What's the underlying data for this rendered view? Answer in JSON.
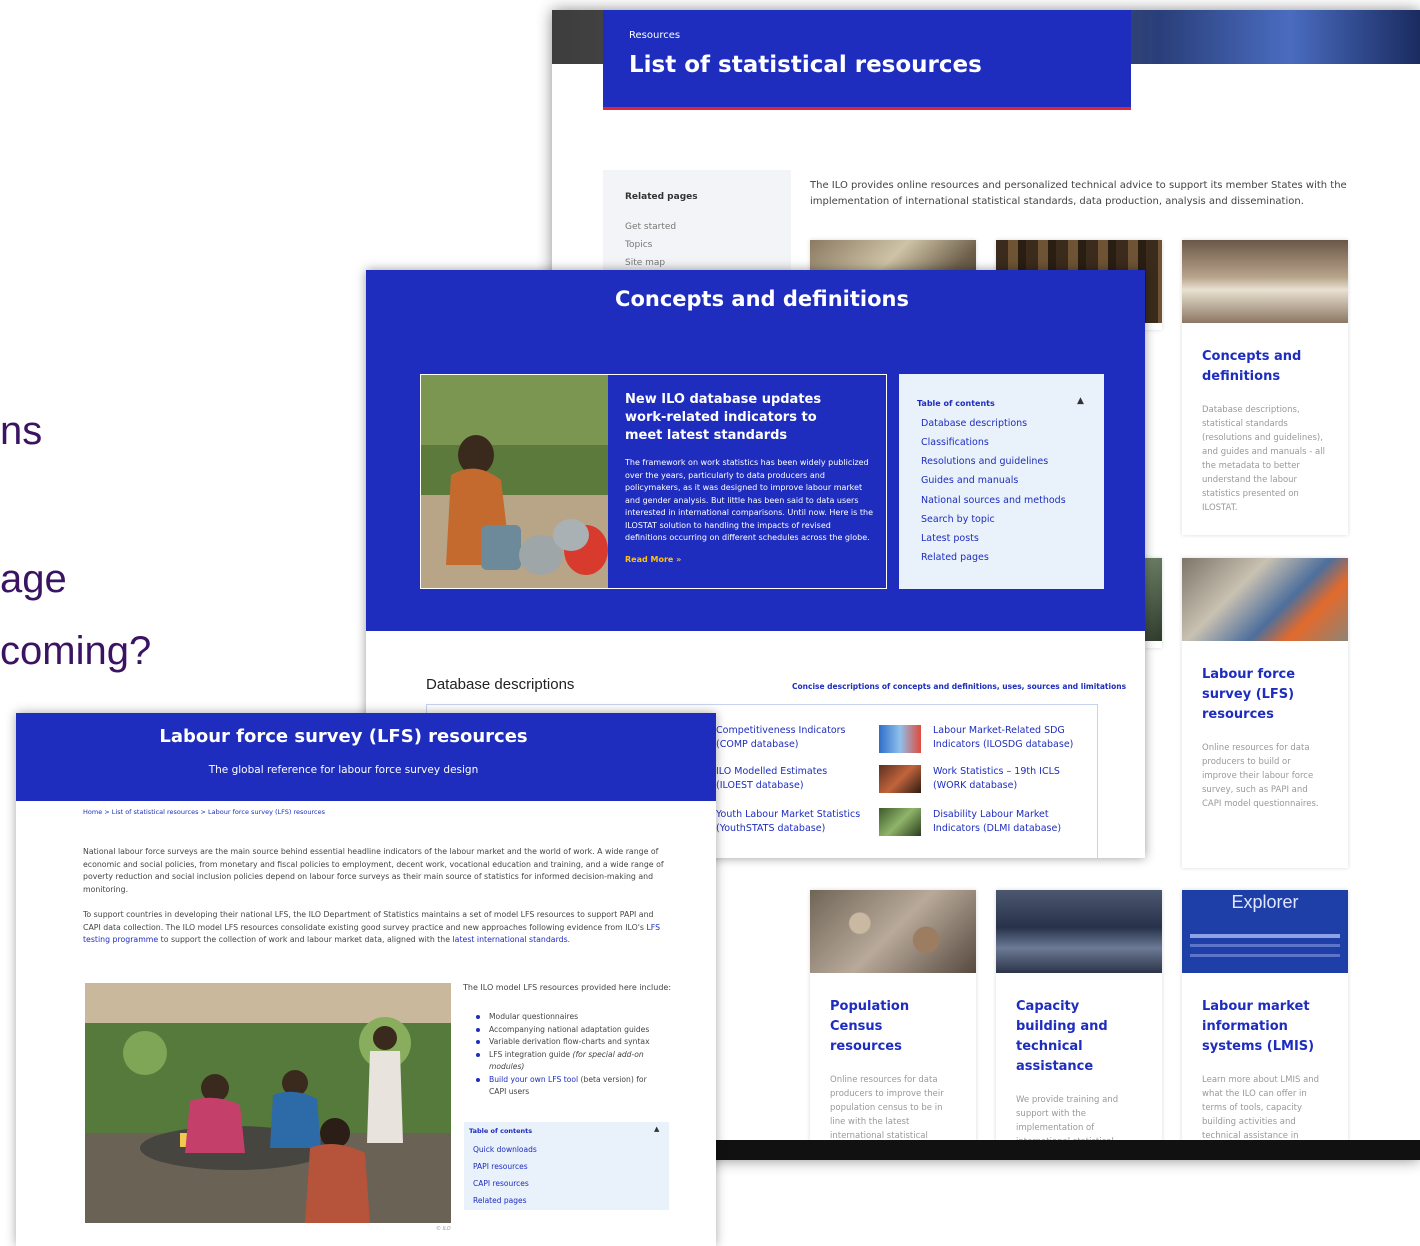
{
  "slide": {
    "fragments": [
      "ns",
      "age",
      "coming?"
    ]
  },
  "list_page": {
    "breadcrumb": "Resources",
    "title": "List of statistical resources",
    "related": {
      "heading": "Related pages",
      "links": [
        "Get started",
        "Topics",
        "Site map"
      ]
    },
    "intro": "The ILO provides online resources and personalized technical advice to support its member States with the implementation of international statistical standards, data production, analysis and dissemination.",
    "cards": [
      {
        "title": "Concepts and definitions",
        "desc": "Database descriptions, statistical standards (resolutions and guidelines), and guides and manuals - all the metadata to better understand the labour statistics presented on ILOSTAT."
      },
      {
        "title": "Labour force survey (LFS) resources",
        "desc": "Online resources for data producers to build or improve their labour force survey, such as PAPI and CAPI model questionnaires."
      },
      {
        "title": "Population Census resources",
        "desc": "Online resources for data producers to improve their population census to be in line with the latest international statistical standards for labour."
      },
      {
        "title": "Capacity building and technical assistance",
        "desc": "We provide training and support with the implementation of international statistical standards, data production"
      },
      {
        "title": "Labour market information systems (LMIS)",
        "desc": "Learn more about LMIS and what the ILO can offer in terms of tools, capacity building activities and technical assistance in"
      }
    ],
    "explorer_logo": "Explorer"
  },
  "concepts_page": {
    "title": "Concepts and definitions",
    "news": {
      "headline": "New ILO database updates work-related indicators to meet latest standards",
      "body": "The framework on work statistics has been widely publicized over the years, particularly to data producers and policymakers, as it was designed to improve labour market and gender analysis. But little has been said to data users interested in international comparisons. Until now. Here is the ILOSTAT solution to handling the impacts of revised definitions occurring on different schedules across the globe.",
      "read_more": "Read More »"
    },
    "toc": {
      "heading": "Table of contents",
      "items": [
        "Database descriptions",
        "Classifications",
        "Resolutions and guidelines",
        "Guides and manuals",
        "National sources and methods",
        "Search by topic",
        "Latest posts",
        "Related pages"
      ]
    },
    "db_heading": "Database descriptions",
    "db_subheading": "Concise descriptions of concepts and definitions, uses, sources and limitations",
    "db_left": [
      "Competitiveness Indicators (COMP database)",
      "ILO Modelled Estimates (ILOEST database)",
      "Youth Labour Market Statistics (YouthSTATS database)"
    ],
    "db_right": [
      "Labour Market-Related SDG Indicators (ILOSDG database)",
      "Work Statistics – 19th ICLS (WORK database)",
      "Disability Labour Market Indicators (DLMI database)"
    ]
  },
  "lfs_page": {
    "title": "Labour force survey (LFS) resources",
    "subtitle": "The global reference for labour force survey design",
    "breadcrumb": "Home > List of statistical resources > Labour force survey (LFS) resources",
    "para1": "National labour force surveys are the main source behind essential headline indicators of the labour market and the world of work. A wide range of economic and social policies, from monetary and fiscal policies to employment, decent work, vocational education and training, and a wide range of poverty reduction and social inclusion policies depend on labour force surveys as their main source of statistics for informed decision-making and monitoring.",
    "para2_a": "To support countries in developing their national LFS, the ILO Department of Statistics maintains a set of model LFS resources to support PAPI and CAPI data collection. The ILO model LFS resources consolidate existing good survey practice and new approaches following evidence from ILO's ",
    "para2_link1": "LFS testing programme",
    "para2_b": " to support the collection of work and labour market data, aligned with the ",
    "para2_link2": "latest international standards",
    "para2_c": ".",
    "right_intro": "The ILO model LFS resources provided here include:",
    "bullets": [
      "Modular questionnaires",
      "Accompanying national adaptation guides",
      "Variable derivation flow-charts and syntax"
    ],
    "bullet_integration": "LFS integration guide ",
    "bullet_integration_note": "(for special add-on modules)",
    "bullet_build_link": "Build your own LFS tool",
    "bullet_build_rest": " (beta version) for CAPI users",
    "photo_credit": "© ILO",
    "toc": {
      "heading": "Table of contents",
      "items": [
        "Quick downloads",
        "PAPI resources",
        "CAPI resources",
        "Related pages"
      ]
    }
  },
  "colors": {
    "ilo_blue": "#1e2dbe",
    "accent_red": "#e0253a",
    "slide_purple": "#3a1462"
  }
}
